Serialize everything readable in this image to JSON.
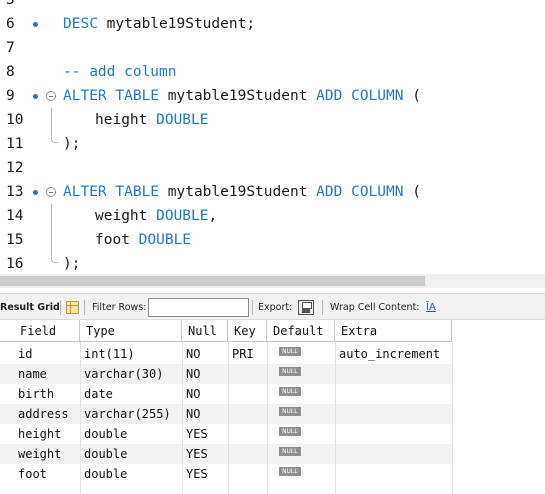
{
  "editor": {
    "lines": [
      {
        "n": "5",
        "text": "",
        "partial": true
      },
      {
        "n": "6",
        "bp": true,
        "tokens": [
          {
            "t": "DESC",
            "k": "kw"
          },
          {
            "t": " mytable19Student;",
            "k": "plain"
          }
        ]
      },
      {
        "n": "7",
        "tokens": []
      },
      {
        "n": "8",
        "tokens": [
          {
            "t": "-- add column",
            "k": "cm"
          }
        ]
      },
      {
        "n": "9",
        "bp": true,
        "fold": "start",
        "tokens": [
          {
            "t": "ALTER TABLE",
            "k": "kw"
          },
          {
            "t": " mytable19Student ",
            "k": "plain"
          },
          {
            "t": "ADD COLUMN",
            "k": "kw"
          },
          {
            "t": " (",
            "k": "plain"
          }
        ]
      },
      {
        "n": "10",
        "fold": "mid",
        "indent": true,
        "tokens": [
          {
            "t": "height ",
            "k": "plain"
          },
          {
            "t": "DOUBLE",
            "k": "kw"
          }
        ]
      },
      {
        "n": "11",
        "fold": "end",
        "tokens": [
          {
            "t": ");",
            "k": "plain"
          }
        ]
      },
      {
        "n": "12",
        "tokens": []
      },
      {
        "n": "13",
        "bp": true,
        "fold": "start",
        "tokens": [
          {
            "t": "ALTER TABLE",
            "k": "kw"
          },
          {
            "t": " mytable19Student ",
            "k": "plain"
          },
          {
            "t": "ADD COLUMN",
            "k": "kw"
          },
          {
            "t": " (",
            "k": "plain"
          }
        ]
      },
      {
        "n": "14",
        "fold": "mid",
        "indent": true,
        "tokens": [
          {
            "t": "weight ",
            "k": "plain"
          },
          {
            "t": "DOUBLE",
            "k": "kw"
          },
          {
            "t": ",",
            "k": "plain"
          }
        ]
      },
      {
        "n": "15",
        "fold": "mid",
        "indent": true,
        "tokens": [
          {
            "t": "foot ",
            "k": "plain"
          },
          {
            "t": "DOUBLE",
            "k": "kw"
          }
        ]
      },
      {
        "n": "16",
        "fold": "end",
        "tokens": [
          {
            "t": ");",
            "k": "plain"
          }
        ]
      }
    ]
  },
  "toolbar": {
    "result_grid_label": "Result Grid",
    "filter_rows_label": "Filter Rows:",
    "filter_rows_value": "",
    "export_label": "Export:",
    "wrap_label": "Wrap Cell Content:",
    "wrap_icon_text": "ĪA"
  },
  "grid": {
    "columns": [
      "Field",
      "Type",
      "Null",
      "Key",
      "Default",
      "Extra"
    ],
    "null_badge": "NULL",
    "rows": [
      [
        "id",
        "int(11)",
        "NO",
        "PRI",
        null,
        "auto_increment"
      ],
      [
        "name",
        "varchar(30)",
        "NO",
        "",
        null,
        ""
      ],
      [
        "birth",
        "date",
        "NO",
        "",
        null,
        ""
      ],
      [
        "address",
        "varchar(255)",
        "NO",
        "",
        null,
        ""
      ],
      [
        "height",
        "double",
        "YES",
        "",
        null,
        ""
      ],
      [
        "weight",
        "double",
        "YES",
        "",
        null,
        ""
      ],
      [
        "foot",
        "double",
        "YES",
        "",
        null,
        ""
      ]
    ]
  },
  "colors": {
    "keyword": "#1f7ac9",
    "breakpoint": "#2b6fc9",
    "row_alt": "#f2f2f2"
  }
}
